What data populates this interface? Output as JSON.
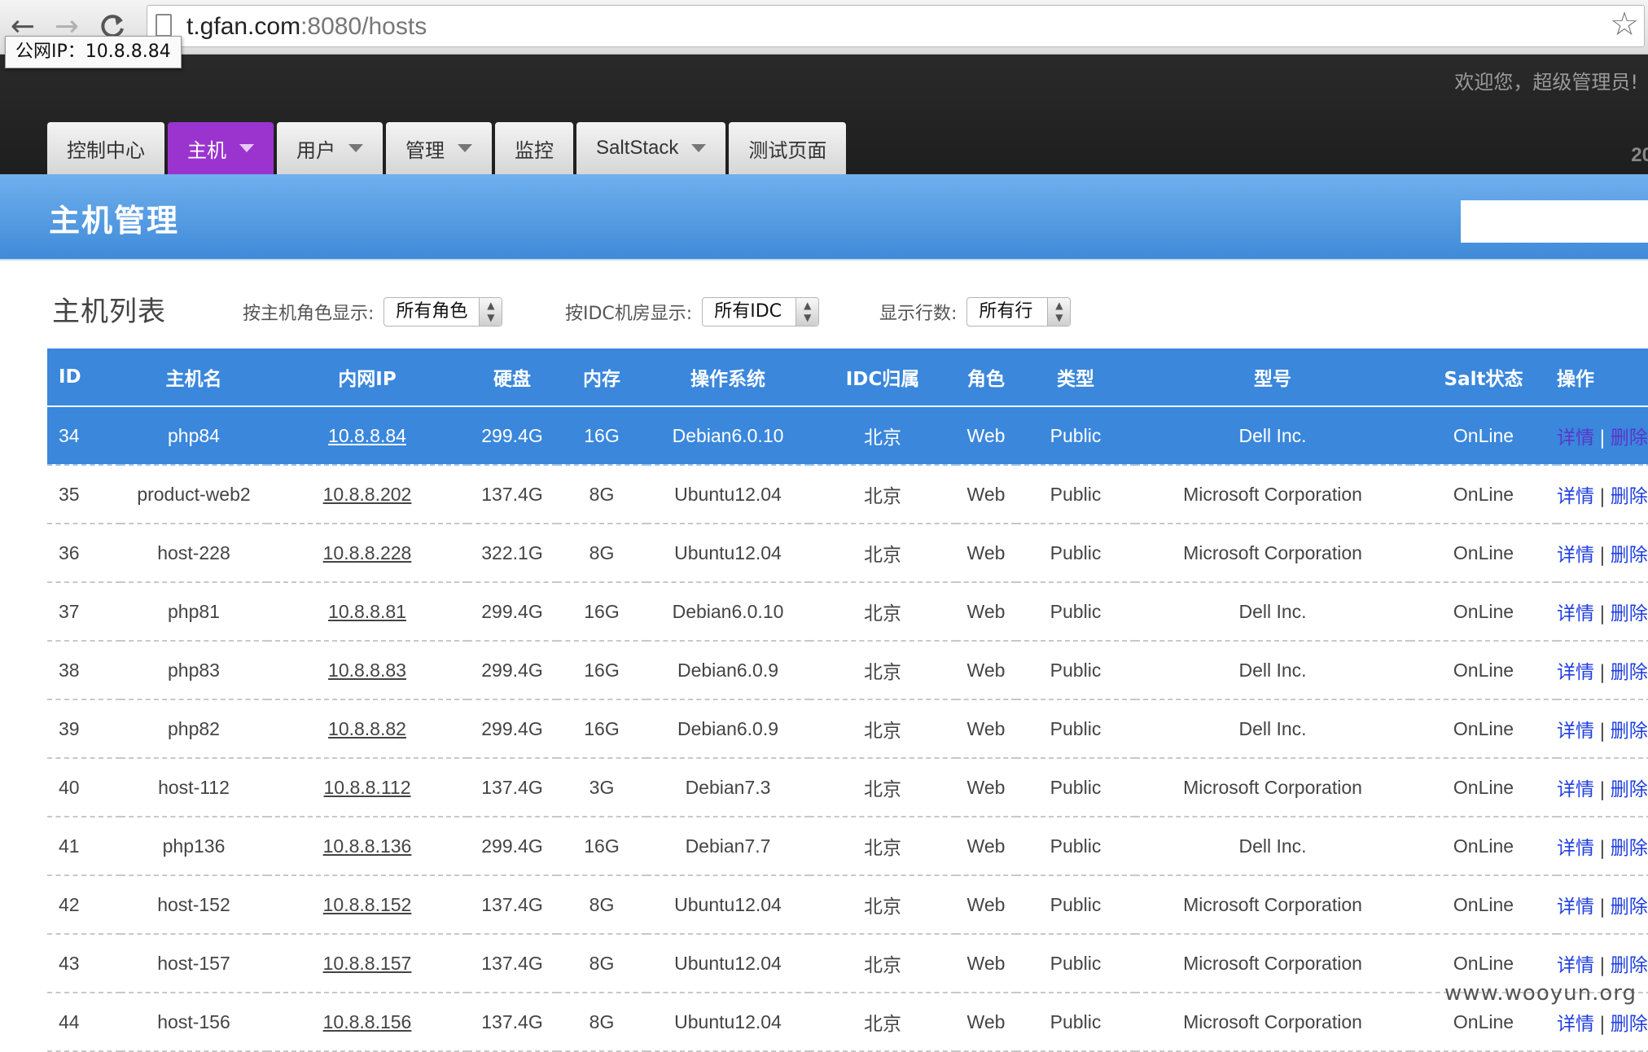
{
  "browser": {
    "back_icon": "←",
    "forward_icon": "→",
    "reload_icon": "C",
    "url_host": "t.gfan.com",
    "url_rest": ":8080/hosts",
    "star_icon": "☆"
  },
  "tooltip": {
    "text": "公网IP：10.8.8.84"
  },
  "header": {
    "welcome": "欢迎您，超级管理员!",
    "year_fragment": "20",
    "tabs": [
      {
        "label": "控制中心",
        "has_menu": false
      },
      {
        "label": "主机",
        "has_menu": true,
        "active": true
      },
      {
        "label": "用户",
        "has_menu": true
      },
      {
        "label": "管理",
        "has_menu": true
      },
      {
        "label": "监控",
        "has_menu": false
      },
      {
        "label": "SaltStack",
        "has_menu": true
      },
      {
        "label": "测试页面",
        "has_menu": false
      }
    ],
    "active_color": "#9b34cf"
  },
  "title_bar": {
    "title": "主机管理",
    "search_value": ""
  },
  "filters": {
    "list_title": "主机列表",
    "role": {
      "label": "按主机角色显示:",
      "value": "所有角色"
    },
    "idc": {
      "label": "按IDC机房显示:",
      "value": "所有IDC"
    },
    "rows": {
      "label": "显示行数:",
      "value": "所有行"
    }
  },
  "table": {
    "header_color": "#3a87dc",
    "columns": [
      "ID",
      "主机名",
      "内网IP",
      "硬盘",
      "内存",
      "操作系统",
      "IDC归属",
      "角色",
      "类型",
      "型号",
      "Salt状态",
      "操作"
    ],
    "detail_label": "详情",
    "separator": "|",
    "delete_label": "删除",
    "rows": [
      {
        "id": "34",
        "name": "php84",
        "ip": "10.8.8.84",
        "disk": "299.4G",
        "mem": "16G",
        "os": "Debian6.0.10",
        "idc": "北京",
        "role": "Web",
        "type": "Public",
        "model": "Dell Inc.",
        "salt": "OnLine",
        "selected": true
      },
      {
        "id": "35",
        "name": "product-web2",
        "ip": "10.8.8.202",
        "disk": "137.4G",
        "mem": "8G",
        "os": "Ubuntu12.04",
        "idc": "北京",
        "role": "Web",
        "type": "Public",
        "model": "Microsoft Corporation",
        "salt": "OnLine"
      },
      {
        "id": "36",
        "name": "host-228",
        "ip": "10.8.8.228",
        "disk": "322.1G",
        "mem": "8G",
        "os": "Ubuntu12.04",
        "idc": "北京",
        "role": "Web",
        "type": "Public",
        "model": "Microsoft Corporation",
        "salt": "OnLine"
      },
      {
        "id": "37",
        "name": "php81",
        "ip": "10.8.8.81",
        "disk": "299.4G",
        "mem": "16G",
        "os": "Debian6.0.10",
        "idc": "北京",
        "role": "Web",
        "type": "Public",
        "model": "Dell Inc.",
        "salt": "OnLine"
      },
      {
        "id": "38",
        "name": "php83",
        "ip": "10.8.8.83",
        "disk": "299.4G",
        "mem": "16G",
        "os": "Debian6.0.9",
        "idc": "北京",
        "role": "Web",
        "type": "Public",
        "model": "Dell Inc.",
        "salt": "OnLine"
      },
      {
        "id": "39",
        "name": "php82",
        "ip": "10.8.8.82",
        "disk": "299.4G",
        "mem": "16G",
        "os": "Debian6.0.9",
        "idc": "北京",
        "role": "Web",
        "type": "Public",
        "model": "Dell Inc.",
        "salt": "OnLine"
      },
      {
        "id": "40",
        "name": "host-112",
        "ip": "10.8.8.112",
        "disk": "137.4G",
        "mem": "3G",
        "os": "Debian7.3",
        "idc": "北京",
        "role": "Web",
        "type": "Public",
        "model": "Microsoft Corporation",
        "salt": "OnLine"
      },
      {
        "id": "41",
        "name": "php136",
        "ip": "10.8.8.136",
        "disk": "299.4G",
        "mem": "16G",
        "os": "Debian7.7",
        "idc": "北京",
        "role": "Web",
        "type": "Public",
        "model": "Dell Inc.",
        "salt": "OnLine"
      },
      {
        "id": "42",
        "name": "host-152",
        "ip": "10.8.8.152",
        "disk": "137.4G",
        "mem": "8G",
        "os": "Ubuntu12.04",
        "idc": "北京",
        "role": "Web",
        "type": "Public",
        "model": "Microsoft Corporation",
        "salt": "OnLine"
      },
      {
        "id": "43",
        "name": "host-157",
        "ip": "10.8.8.157",
        "disk": "137.4G",
        "mem": "8G",
        "os": "Ubuntu12.04",
        "idc": "北京",
        "role": "Web",
        "type": "Public",
        "model": "Microsoft Corporation",
        "salt": "OnLine"
      },
      {
        "id": "44",
        "name": "host-156",
        "ip": "10.8.8.156",
        "disk": "137.4G",
        "mem": "8G",
        "os": "Ubuntu12.04",
        "idc": "北京",
        "role": "Web",
        "type": "Public",
        "model": "Microsoft Corporation",
        "salt": "OnLine"
      }
    ]
  },
  "watermark": "www.wooyun.org"
}
